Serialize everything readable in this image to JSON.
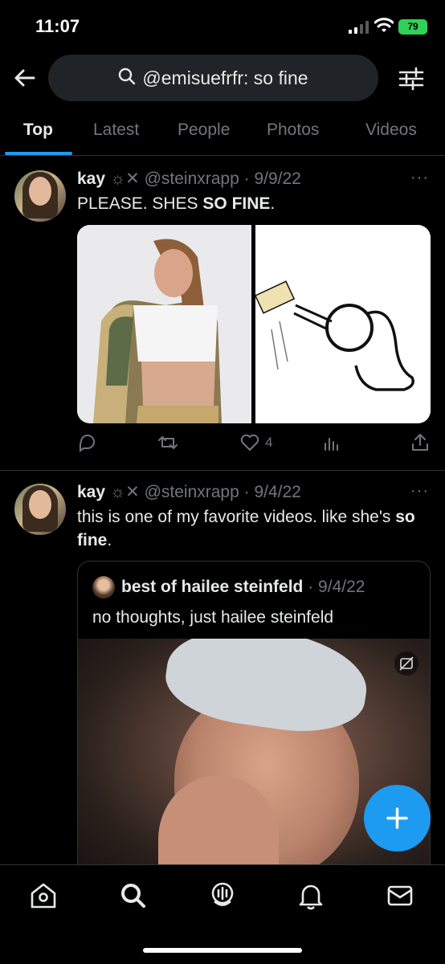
{
  "status_bar": {
    "time": "11:07",
    "battery": "79"
  },
  "header": {
    "back_icon": "arrow-left-icon",
    "search_query": "@emisuefrfr: so fine",
    "filter_icon": "sliders-icon"
  },
  "tabs": [
    "Top",
    "Latest",
    "People",
    "Photos",
    "Videos"
  ],
  "tweets": [
    {
      "name": "kay",
      "name_suffix": "☼✕",
      "handle": "@steinxrapp",
      "date": "· 9/9/22",
      "text_before": "PLEASE. SHES ",
      "text_bold": "SO FINE",
      "text_after": ".",
      "likes": "4"
    },
    {
      "name": "kay",
      "name_suffix": "☼✕",
      "handle": "@steinxrapp",
      "date": "· 9/4/22",
      "text_before": "this is one of my favorite videos. like she's ",
      "text_bold": "so fine",
      "text_after": ".",
      "quote": {
        "name": "best of hailee steinfeld",
        "date": "· 9/4/22",
        "text": "no thoughts, just hailee steinfeld"
      }
    }
  ],
  "more_label": "···",
  "colors": {
    "accent": "#1d9bf0",
    "background": "#000000",
    "muted": "#71767b",
    "battery": "#30d158"
  }
}
